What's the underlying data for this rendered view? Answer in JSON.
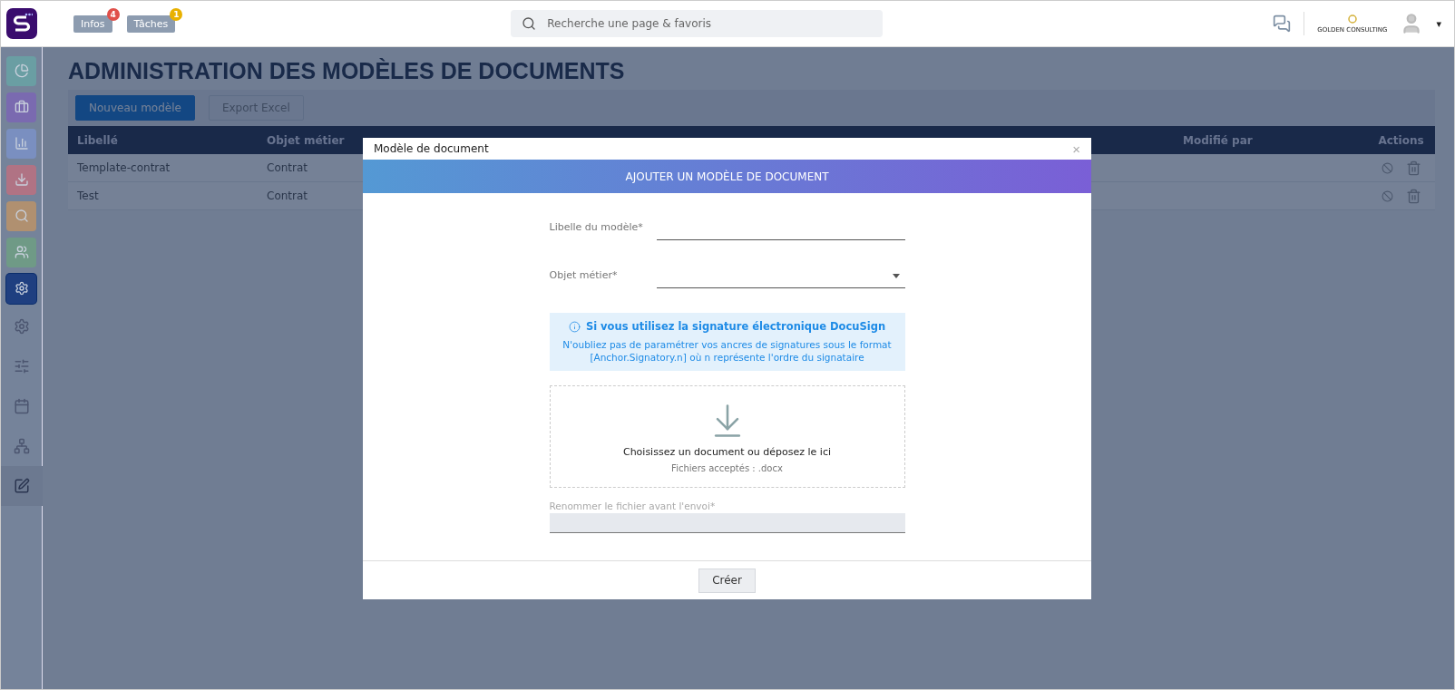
{
  "topbar": {
    "pills": [
      {
        "label": "Infos",
        "count": "4",
        "color": "#e0504a"
      },
      {
        "label": "Tâches",
        "count": "1",
        "color": "#e8b100"
      }
    ],
    "search": {
      "placeholder": "Recherche une page & favoris"
    },
    "company": "GOLDEN CONSULTING",
    "menu_caret": "▾"
  },
  "sidebar": {
    "items": [
      {
        "kind": "tile",
        "color": "#6a9ea3",
        "selected": false
      },
      {
        "kind": "tile",
        "color": "#7a6ab0",
        "selected": false
      },
      {
        "kind": "tile",
        "color": "#7a8fc0",
        "selected": false
      },
      {
        "kind": "tile",
        "color": "#b07384",
        "selected": false
      },
      {
        "kind": "tile",
        "color": "#b09070",
        "selected": false
      },
      {
        "kind": "tile",
        "color": "#6f9a86",
        "selected": false
      },
      {
        "kind": "tile",
        "color": "#1f3f80",
        "selected": true
      },
      {
        "kind": "plain",
        "selected": false
      },
      {
        "kind": "plain",
        "selected": false
      },
      {
        "kind": "plain",
        "selected": false
      },
      {
        "kind": "plain",
        "selected": false
      },
      {
        "kind": "plain",
        "selected": true
      }
    ]
  },
  "page": {
    "title": "ADMINISTRATION DES MODÈLES DE DOCUMENTS",
    "buttons": [
      {
        "label": "Nouveau modèle",
        "kind": "primary"
      },
      {
        "label": "Export Excel",
        "kind": "secondary"
      }
    ],
    "table": {
      "columns": [
        "Libellé",
        "Objet métier",
        "",
        "",
        "Modifié par",
        "Actions"
      ],
      "rows": [
        {
          "cells": [
            "Template-contrat",
            "Contrat"
          ]
        },
        {
          "cells": [
            "Test",
            "Contrat"
          ]
        }
      ]
    }
  },
  "modal": {
    "title": "Modèle de document",
    "close": "×",
    "banner": "AJOUTER UN MODÈLE DE DOCUMENT",
    "fields": [
      {
        "kind": "text",
        "label": "Libelle du modèle*"
      },
      {
        "kind": "select",
        "label": "Objet métier*"
      }
    ],
    "info": {
      "title": "Si vous utilisez la signature électronique DocuSign",
      "text": "N'oubliez pas de paramétrer vos ancres de signatures sous le format [Anchor.Signatory.n] où n représente l'ordre du signataire"
    },
    "dropzone": {
      "text": "Choisissez un document ou déposez le ici",
      "hint": "Fichiers acceptés : .docx"
    },
    "rename": {
      "label": "Renommer le fichier avant l'envoi*",
      "disabled": true
    },
    "submit": "Créer"
  }
}
